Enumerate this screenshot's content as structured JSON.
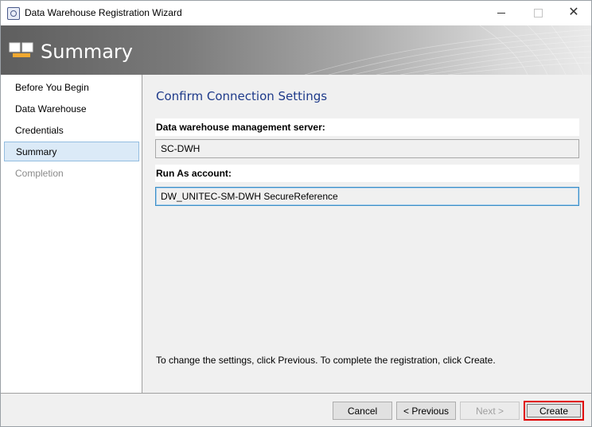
{
  "window": {
    "title": "Data Warehouse Registration Wizard"
  },
  "banner": {
    "title": "Summary",
    "icon": "wizard-pages-icon"
  },
  "sidebar": {
    "items": [
      {
        "label": "Before You Begin",
        "state": "normal"
      },
      {
        "label": "Data Warehouse",
        "state": "normal"
      },
      {
        "label": "Credentials",
        "state": "normal"
      },
      {
        "label": "Summary",
        "state": "active"
      },
      {
        "label": "Completion",
        "state": "disabled"
      }
    ]
  },
  "main": {
    "section_title": "Confirm Connection Settings",
    "server_label": "Data warehouse management server:",
    "server_value": "SC-DWH",
    "runas_label": "Run As account:",
    "runas_value": "DW_UNITEC-SM-DWH SecureReference",
    "hint": "To change the settings, click Previous. To complete the registration, click Create."
  },
  "footer": {
    "cancel_label": "Cancel",
    "previous_label": "< Previous",
    "next_label": "Next >",
    "create_label": "Create"
  },
  "colors": {
    "accent_title": "#1e3a8a",
    "active_nav_bg": "#dbeaf7",
    "highlight_border": "#e00000"
  }
}
